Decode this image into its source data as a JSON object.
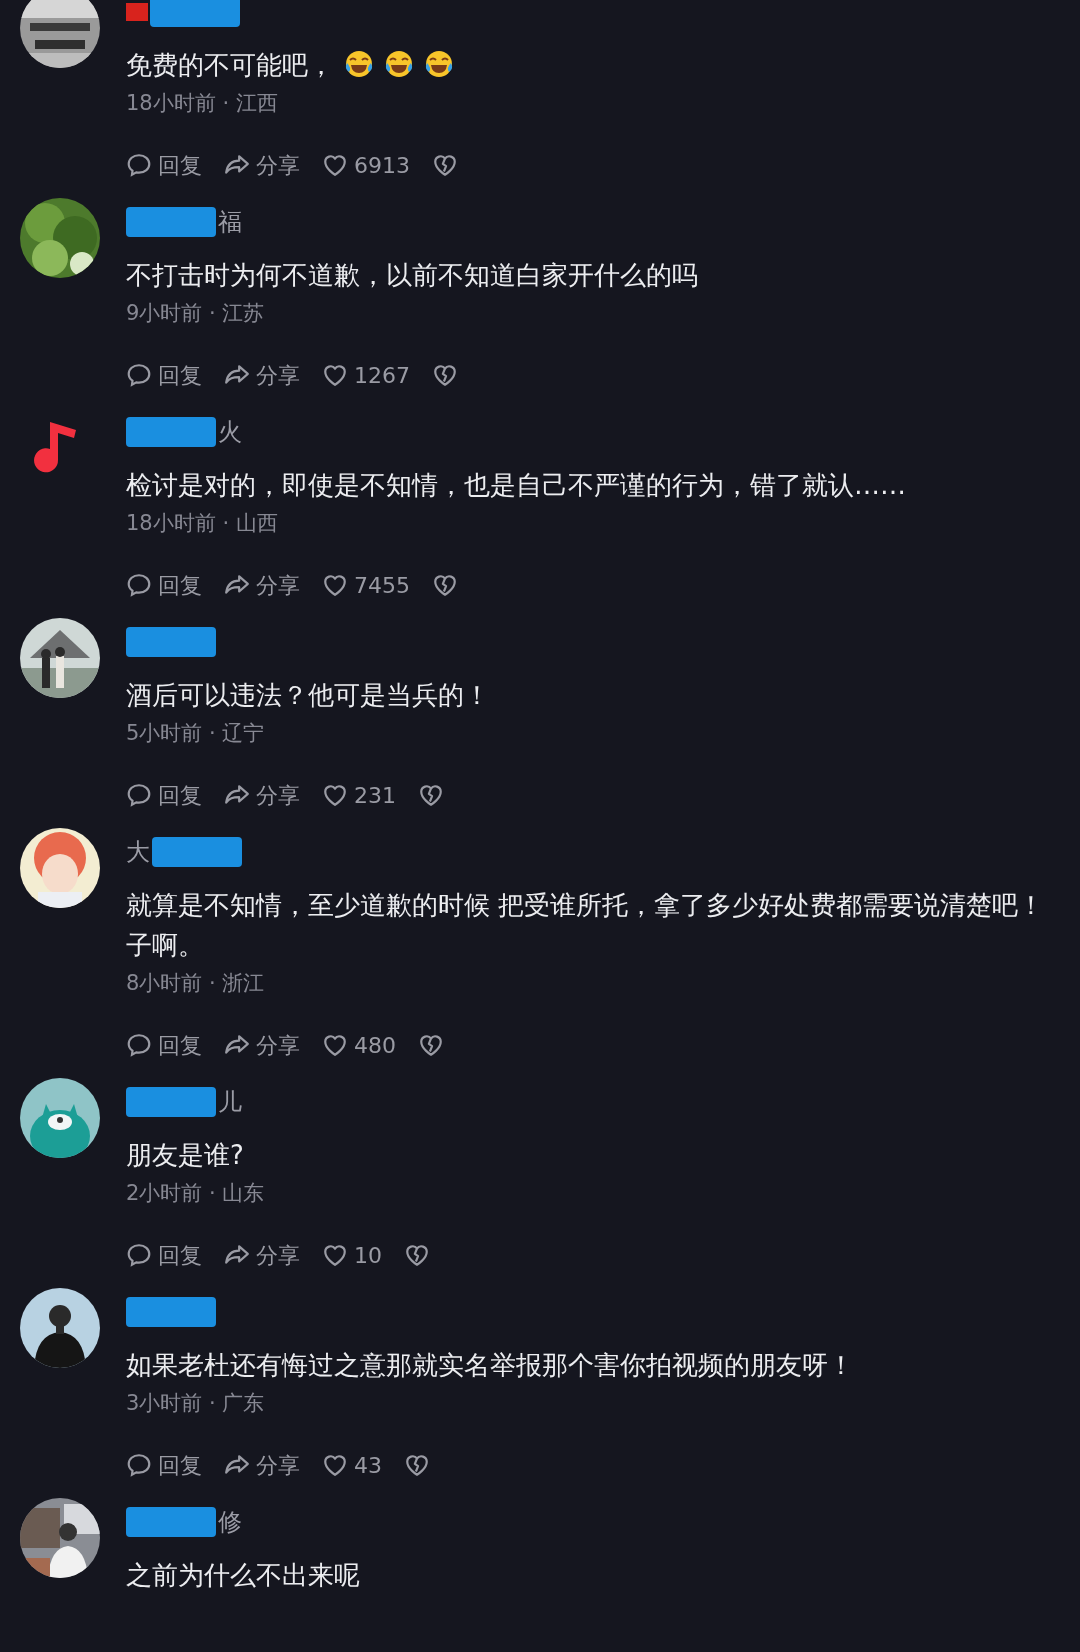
{
  "comments": [
    {
      "avatar": {
        "kind": "picture"
      },
      "flag": true,
      "redacted": true,
      "lines": [
        "免费的不可能吧，"
      ],
      "emojis": [
        {
          "kind": "tears-of-joy"
        },
        {
          "kind": "tears-of-joy"
        },
        {
          "kind": "tears-of-joy"
        }
      ],
      "meta": "18小时前 · 江西",
      "actions": {
        "reply": "回复",
        "share": "分享",
        "likes": "6913"
      }
    },
    {
      "avatar": {
        "kind": "picture"
      },
      "redacted": true,
      "name_after": "福",
      "lines": [
        "不打击时为何不道歉，以前不知道白家开什么的吗"
      ],
      "meta": "9小时前 · 江苏",
      "actions": {
        "reply": "回复",
        "share": "分享",
        "likes": "1267"
      }
    },
    {
      "avatar": {
        "kind": "note"
      },
      "redacted": true,
      "name_after": "火",
      "lines": [
        "检讨是对的，即使是不知情，也是自己不严谨的行为，错了就认……"
      ],
      "meta": "18小时前 · 山西",
      "actions": {
        "reply": "回复",
        "share": "分享",
        "likes": "7455"
      }
    },
    {
      "avatar": {
        "kind": "picture"
      },
      "redacted": true,
      "lines": [
        "酒后可以违法？他可是当兵的！"
      ],
      "meta": "5小时前 · 辽宁",
      "actions": {
        "reply": "回复",
        "share": "分享",
        "likes": "231"
      }
    },
    {
      "avatar": {
        "kind": "picture"
      },
      "redacted": true,
      "name_before": "大",
      "lines": [
        "就算是不知情，至少道歉的时候 把受谁所托，拿了多少好处费都需要说清楚吧！",
        "子啊。"
      ],
      "meta": "8小时前 · 浙江",
      "actions": {
        "reply": "回复",
        "share": "分享",
        "likes": "480"
      }
    },
    {
      "avatar": {
        "kind": "picture"
      },
      "redacted": true,
      "name_after": "儿",
      "lines": [
        "朋友是谁?"
      ],
      "meta": "2小时前 · 山东",
      "actions": {
        "reply": "回复",
        "share": "分享",
        "likes": "10"
      }
    },
    {
      "avatar": {
        "kind": "picture"
      },
      "redacted": true,
      "lines": [
        "如果老杜还有悔过之意那就实名举报那个害你拍视频的朋友呀！"
      ],
      "meta": "3小时前 · 广东",
      "actions": {
        "reply": "回复",
        "share": "分享",
        "likes": "43"
      }
    },
    {
      "avatar": {
        "kind": "picture"
      },
      "redacted": true,
      "name_after": "修",
      "lines": [
        "之前为什么不出来呢"
      ]
    }
  ]
}
